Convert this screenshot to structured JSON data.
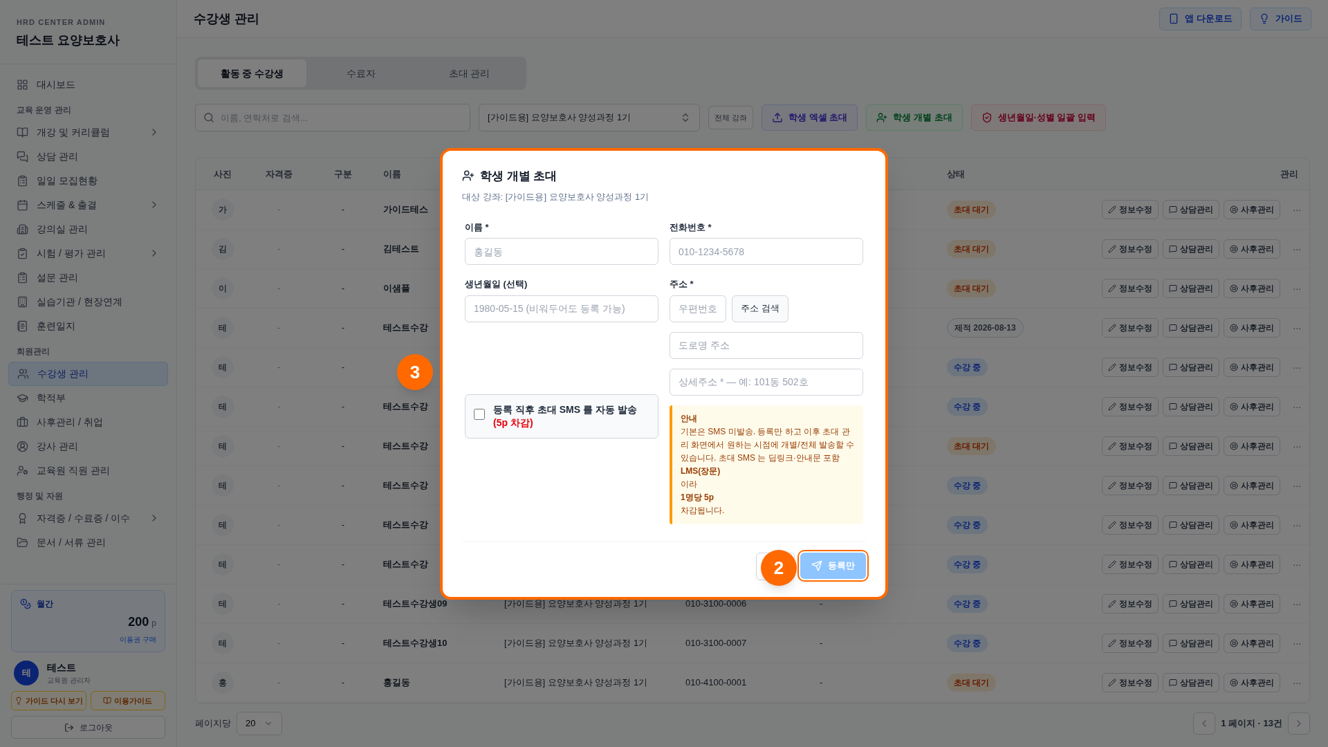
{
  "sidebar": {
    "org_label": "HRD CENTER ADMIN",
    "org_name": "테스트 요양보호사",
    "sections": [
      {
        "items": [
          {
            "label": "대시보드",
            "selected": false,
            "expandable": false
          }
        ]
      },
      {
        "heading": "교육 운영 관리",
        "items": [
          {
            "label": "개강 및 커리큘럼",
            "selected": false,
            "expandable": true
          },
          {
            "label": "상담 관리",
            "selected": false,
            "expandable": false
          },
          {
            "label": "일일 모집현황",
            "selected": false,
            "expandable": false
          },
          {
            "label": "스케줄 & 출결",
            "selected": false,
            "expandable": true
          },
          {
            "label": "강의실 관리",
            "selected": false,
            "expandable": false
          },
          {
            "label": "시험 / 평가 관리",
            "selected": false,
            "expandable": true
          },
          {
            "label": "설문 관리",
            "selected": false,
            "expandable": false
          },
          {
            "label": "실습기관 / 현장연계",
            "selected": false,
            "expandable": false
          },
          {
            "label": "훈련일지",
            "selected": false,
            "expandable": false
          }
        ]
      },
      {
        "heading": "회원관리",
        "items": [
          {
            "label": "수강생 관리",
            "selected": true,
            "expandable": false
          },
          {
            "label": "학적부",
            "selected": false,
            "expandable": false
          },
          {
            "label": "사후관리 / 취업",
            "selected": false,
            "expandable": false
          },
          {
            "label": "강사 관리",
            "selected": false,
            "expandable": false
          },
          {
            "label": "교육원 직원 관리",
            "selected": false,
            "expandable": false
          }
        ]
      },
      {
        "heading": "행정 및 자원",
        "items": [
          {
            "label": "자격증 / 수료증 / 이수",
            "selected": false,
            "expandable": true
          },
          {
            "label": "문서 / 서류 관리",
            "selected": false,
            "expandable": false
          }
        ]
      }
    ],
    "points": {
      "label": "월간",
      "amount": "200",
      "unit": "p",
      "link": "이용권 구매"
    },
    "user": {
      "avatar": "테",
      "name": "테스트",
      "role": "교육원 관리자"
    },
    "buttons": [
      "가이드 다시 보기",
      "이용가이드"
    ],
    "logout": "로그아웃"
  },
  "header": {
    "title": "수강생 관리",
    "buttons": [
      "앱 다운로드",
      "가이드"
    ]
  },
  "tabs": [
    {
      "label": "활동 중 수강생",
      "selected": true
    },
    {
      "label": "수료자",
      "selected": false
    },
    {
      "label": "초대 관리",
      "selected": false
    }
  ],
  "toolbar": {
    "search_placeholder": "이름, 연락처로 검색...",
    "course_select": "[가이드용] 요양보호사 양성과정 1기",
    "all_courses": "전체 강좌",
    "actions": [
      {
        "label": "학생 엑셀 초대",
        "kind": "excel"
      },
      {
        "label": "학생 개별 초대",
        "kind": "single"
      },
      {
        "label": "생년월일·성별 일괄 입력",
        "kind": "bulk"
      }
    ]
  },
  "table": {
    "columns": [
      "사진",
      "자격증",
      "구분",
      "이름",
      "상태",
      "관리"
    ],
    "rows": [
      {
        "avatar": "가",
        "certificate": "-",
        "type": "-",
        "name": "가이드테스",
        "status": {
          "label": "초대 대기",
          "kind": "pending"
        },
        "actions": [
          "정보수정",
          "상담관리",
          "사후관리"
        ],
        "more": "···"
      },
      {
        "avatar": "김",
        "certificate": "-",
        "type": "-",
        "name": "김테스트",
        "status": {
          "label": "초대 대기",
          "kind": "pending"
        },
        "actions": [
          "정보수정",
          "상담관리",
          "사후관리"
        ],
        "more": "···"
      },
      {
        "avatar": "이",
        "certificate": "-",
        "type": "-",
        "name": "이샘플",
        "status": {
          "label": "초대 대기",
          "kind": "pending"
        },
        "actions": [
          "정보수정",
          "상담관리",
          "사후관리"
        ],
        "more": "···"
      },
      {
        "avatar": "테",
        "certificate": "-",
        "type": "-",
        "name": "테스트수강",
        "status": {
          "label": "제적 2026-08-13",
          "kind": "expelled"
        },
        "actions": [
          "정보수정",
          "상담관리",
          "사후관리"
        ],
        "more": "···"
      },
      {
        "avatar": "테",
        "certificate": "-",
        "type": "-",
        "status": {
          "label": "수강 중",
          "kind": "active"
        },
        "actions": [
          "정보수정",
          "상담관리",
          "사후관리"
        ],
        "more": "···"
      },
      {
        "avatar": "테",
        "certificate": "-",
        "type": "-",
        "name": "테스트수강",
        "status": {
          "label": "수강 중",
          "kind": "active"
        },
        "actions": [
          "정보수정",
          "상담관리",
          "사후관리"
        ],
        "more": "···"
      },
      {
        "avatar": "테",
        "certificate": "-",
        "type": "-",
        "name": "테스트수강",
        "status": {
          "label": "초대 대기",
          "kind": "pending"
        },
        "actions": [
          "정보수정",
          "상담관리",
          "사후관리"
        ],
        "more": "···"
      },
      {
        "avatar": "테",
        "certificate": "-",
        "type": "-",
        "name": "테스트수강",
        "status": {
          "label": "수강 중",
          "kind": "active"
        },
        "actions": [
          "정보수정",
          "상담관리",
          "사후관리"
        ],
        "more": "···"
      },
      {
        "avatar": "테",
        "certificate": "-",
        "type": "-",
        "name": "테스트수강",
        "status": {
          "label": "수강 중",
          "kind": "active"
        },
        "actions": [
          "정보수정",
          "상담관리",
          "사후관리"
        ],
        "more": "···"
      },
      {
        "avatar": "테",
        "certificate": "-",
        "type": "-",
        "name": "테스트수강",
        "status": {
          "label": "수강 중",
          "kind": "active"
        },
        "actions": [
          "정보수정",
          "상담관리",
          "사후관리"
        ],
        "more": "···"
      },
      {
        "avatar": "테",
        "certificate": "-",
        "type": "-",
        "name": "테스트수강생09",
        "column_5": "[가이드용] 요양보호사 양성과정 1기",
        "column_6": "010-3100-0006",
        "column_7": "-",
        "status": {
          "label": "수강 중",
          "kind": "active"
        },
        "actions": [
          "정보수정",
          "상담관리",
          "사후관리"
        ],
        "more": "···"
      },
      {
        "avatar": "테",
        "certificate": "-",
        "type": "-",
        "name": "테스트수강생10",
        "column_5": "[가이드용] 요양보호사 양성과정 1기",
        "column_6": "010-3100-0007",
        "column_7": "-",
        "status": {
          "label": "수강 중",
          "kind": "active"
        },
        "actions": [
          "정보수정",
          "상담관리",
          "사후관리"
        ],
        "more": "···"
      },
      {
        "avatar": "홍",
        "certificate": "-",
        "type": "-",
        "name": "홍길동",
        "column_5": "[가이드용] 요양보호사 양성과정 1기",
        "column_6": "010-4100-0001",
        "column_7": "-",
        "status": {
          "label": "초대 대기",
          "kind": "pending"
        },
        "actions": [
          "정보수정",
          "상담관리",
          "사후관리"
        ],
        "more": "···"
      }
    ]
  },
  "pagination": {
    "per_page_label": "페이지당",
    "per_page": "20",
    "info": "1 페이지 · 13건"
  },
  "dialog": {
    "title": "학생 개별 초대",
    "subtitle": "대상 강좌: [가이드용] 요양보호사 양성과정 1기",
    "name": {
      "label": "이름 *",
      "placeholder": "홍길동"
    },
    "phone": {
      "label": "전화번호 *",
      "placeholder": "010-1234-5678"
    },
    "birth": {
      "label": "생년월일 (선택)",
      "placeholder": "1980-05-15 (비워두어도 등록 가능)"
    },
    "address": {
      "label": "주소 *",
      "zip_placeholder": "우편번호",
      "search_button": "주소 검색",
      "road_placeholder": "도로명 주소",
      "detail_placeholder": "상세주소 * — 예: 101동 502호"
    },
    "sms_option": {
      "label": "등록 직후 초대 SMS 를 자동 발송",
      "cost": "(5p 차감)",
      "checked": false
    },
    "notice": {
      "title": "안내",
      "lines": [
        {
          "text": "기본은 SMS 미발송. 등록만 하고 이후 초대 관리 화면에서 원하는 시점에 개별/전체 발송할 수 있습니다. 초대 SMS 는 딥링크·안내문 포함",
          "kind": "plain"
        },
        {
          "text": "LMS(장문)",
          "kind": "strong"
        },
        {
          "text": "이라",
          "kind": "plain"
        },
        {
          "text": "1명당 5p",
          "kind": "strong"
        },
        {
          "text": "차감됩니다.",
          "kind": "plain"
        }
      ]
    },
    "submit": {
      "label": "등록만",
      "disabled": true
    }
  },
  "step_markers": [
    {
      "label": "3"
    },
    {
      "label": "2"
    }
  ]
}
